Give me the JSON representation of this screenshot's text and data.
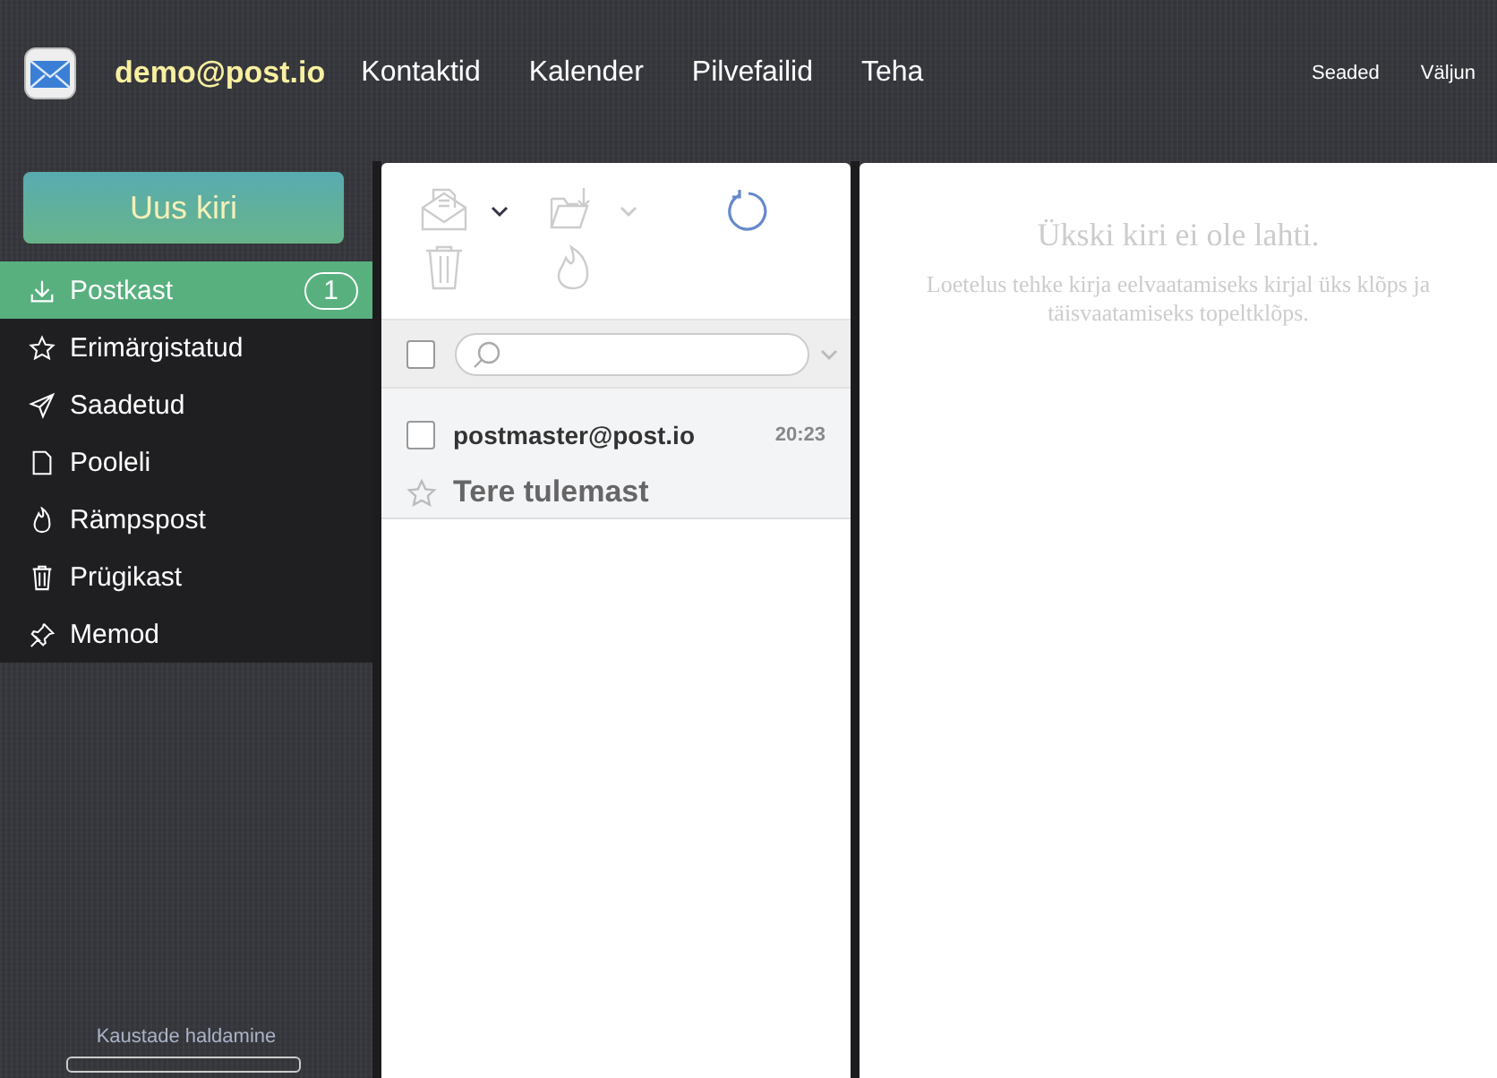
{
  "header": {
    "account": "demo@post.io",
    "nav": [
      {
        "label": "Kontaktid"
      },
      {
        "label": "Kalender"
      },
      {
        "label": "Pilvefailid"
      },
      {
        "label": "Teha"
      }
    ],
    "links": [
      {
        "label": "Seaded"
      },
      {
        "label": "Väljun"
      }
    ]
  },
  "sidebar": {
    "compose": "Uus kiri",
    "folders": [
      {
        "kind": "inbox",
        "label": "Postkast",
        "count": "1",
        "selected": true
      },
      {
        "kind": "starred",
        "label": "Erimärgistatud",
        "selected": false
      },
      {
        "kind": "sent",
        "label": "Saadetud",
        "selected": false
      },
      {
        "kind": "drafts",
        "label": "Pooleli",
        "selected": false
      },
      {
        "kind": "spam",
        "label": "Rämpspost",
        "selected": false
      },
      {
        "kind": "trash",
        "label": "Prügikast",
        "selected": false
      },
      {
        "kind": "notes",
        "label": "Memod",
        "selected": false
      }
    ],
    "manage": "Kaustade haldamine",
    "quota": {
      "level": 0
    }
  },
  "select_all": {
    "checked": false
  },
  "messages": [
    {
      "sender": "postmaster@post.io",
      "time": "20:23",
      "subject": "Tere tulemast",
      "checked": false,
      "starred": false
    }
  ],
  "reading_pane": {
    "title": "Ükski kiri ei ole lahti.",
    "hint": "Loetelus tehke kirja eelvaatamiseks kirjal üks klõps ja täisvaatamiseks topeltklõps."
  }
}
